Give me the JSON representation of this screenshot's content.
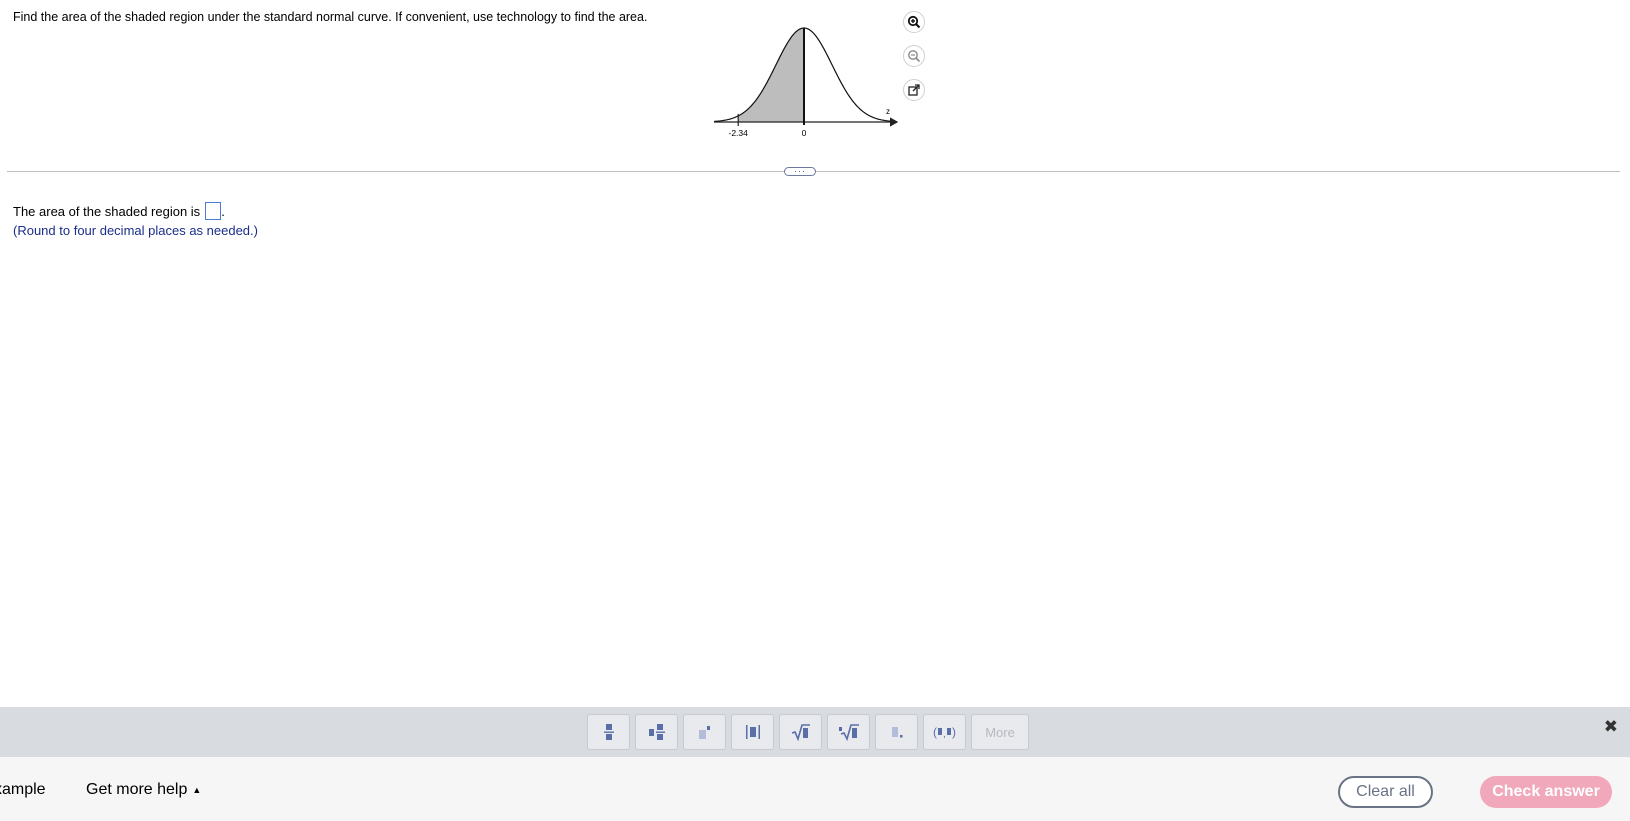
{
  "question": {
    "text": "Find the area of the shaded region under the standard normal curve. If convenient, use technology to find the area."
  },
  "figure": {
    "axis_label": "z",
    "tick_labels": [
      "-2.34",
      "0"
    ],
    "shade_from": -2.34,
    "shade_to": 0,
    "icons": [
      "zoom-in-icon",
      "zoom-out-icon",
      "popout-icon"
    ]
  },
  "answer": {
    "prefix": "The area of the shaded region is",
    "suffix": ".",
    "hint": "(Round to four decimal places as needed.)"
  },
  "math_toolbar": {
    "more_label": "More",
    "close_glyph": "✖"
  },
  "footer": {
    "example_label": "xample",
    "help_label": "Get more help",
    "help_caret": "▲",
    "clear_label": "Clear all",
    "check_label": "Check answer"
  },
  "colors": {
    "accent_pink": "#f0a8ba",
    "hint_blue": "#1b2e8a",
    "toolbar_gray": "#d8dbe0"
  }
}
